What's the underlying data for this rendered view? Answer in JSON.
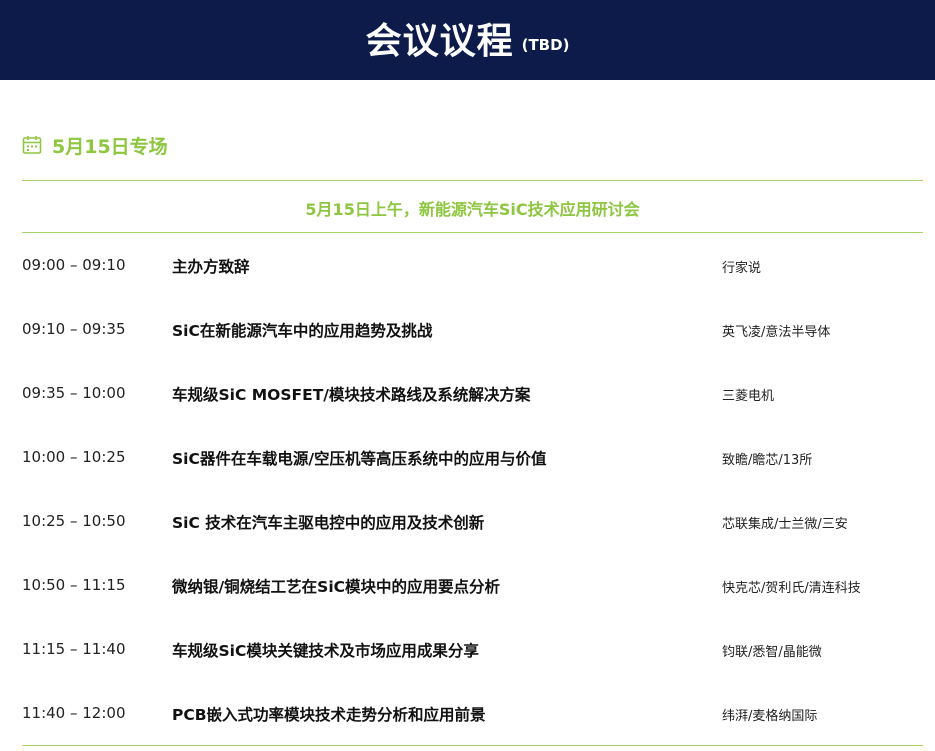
{
  "header": {
    "title": "会议议程",
    "subtitle": "(TBD)"
  },
  "day": {
    "icon": "calendar-icon",
    "label": "5月15日专场"
  },
  "session": {
    "title": "5月15日上午，新能源汽车SiC技术应用研讨会"
  },
  "agenda": [
    {
      "time": "09:00 – 09:10",
      "topic": "主办方致辞",
      "speaker": "行家说"
    },
    {
      "time": "09:10 – 09:35",
      "topic": "SiC在新能源汽车中的应用趋势及挑战",
      "speaker": "英飞凌/意法半导体"
    },
    {
      "time": "09:35 – 10:00",
      "topic": "车规级SiC MOSFET/模块技术路线及系统解决方案",
      "speaker": "三菱电机"
    },
    {
      "time": "10:00 – 10:25",
      "topic": "SiC器件在车载电源/空压机等高压系统中的应用与价值",
      "speaker": "致瞻/瞻芯/13所"
    },
    {
      "time": "10:25 – 10:50",
      "topic": "SiC 技术在汽车主驱电控中的应用及技术创新",
      "speaker": "芯联集成/士兰微/三安"
    },
    {
      "time": "10:50 – 11:15",
      "topic": "微纳银/铜烧结工艺在SiC模块中的应用要点分析",
      "speaker": "快克芯/贺利氏/清连科技"
    },
    {
      "time": "11:15 – 11:40",
      "topic": "车规级SiC模块关键技术及市场应用成果分享",
      "speaker": "钧联/悉智/晶能微"
    },
    {
      "time": "11:40 – 12:00",
      "topic": "PCB嵌入式功率模块技术走势分析和应用前景",
      "speaker": "纬湃/麦格纳国际"
    }
  ],
  "colors": {
    "header_bg": "#0d1b4a",
    "accent_green": "#8dc63f"
  }
}
